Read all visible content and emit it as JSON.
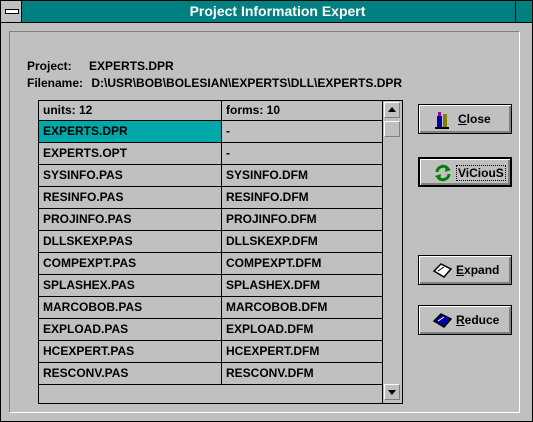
{
  "window": {
    "title": "Project Information Expert"
  },
  "info": {
    "project_label": "Project:",
    "project_value": "EXPERTS.DPR",
    "filename_label": "Filename:",
    "filename_value": "D:\\USR\\BOB\\BOLESIAN\\EXPERTS\\DLL\\EXPERTS.DPR"
  },
  "grid": {
    "columns": [
      "units: 12",
      "forms: 10"
    ],
    "rows": [
      [
        "EXPERTS.DPR",
        "-"
      ],
      [
        "EXPERTS.OPT",
        "-"
      ],
      [
        "SYSINFO.PAS",
        "SYSINFO.DFM"
      ],
      [
        "RESINFO.PAS",
        "RESINFO.DFM"
      ],
      [
        "PROJINFO.PAS",
        "PROJINFO.DFM"
      ],
      [
        "DLLSKEXP.PAS",
        "DLLSKEXP.DFM"
      ],
      [
        "COMPEXPT.PAS",
        "COMPEXPT.DFM"
      ],
      [
        "SPLASHEX.PAS",
        "SPLASHEX.DFM"
      ],
      [
        "MARCOBOB.PAS",
        "MARCOBOB.DFM"
      ],
      [
        "EXPLOAD.PAS",
        "EXPLOAD.DFM"
      ],
      [
        "HCEXPERT.PAS",
        "HCEXPERT.DFM"
      ],
      [
        "RESCONV.PAS",
        "RESCONV.DFM"
      ]
    ]
  },
  "buttons": {
    "close": "Close",
    "vicious": "ViCiouS",
    "expand": "Expand",
    "reduce": "Reduce"
  },
  "icons": {
    "close": "door-exit-icon",
    "vicious": "refresh-arrows-icon",
    "expand": "diamond-outline-icon",
    "reduce": "diamond-filled-icon"
  },
  "colors": {
    "titlebar": "#008080",
    "selection": "#00a8a8",
    "face": "#c0c0c0"
  }
}
